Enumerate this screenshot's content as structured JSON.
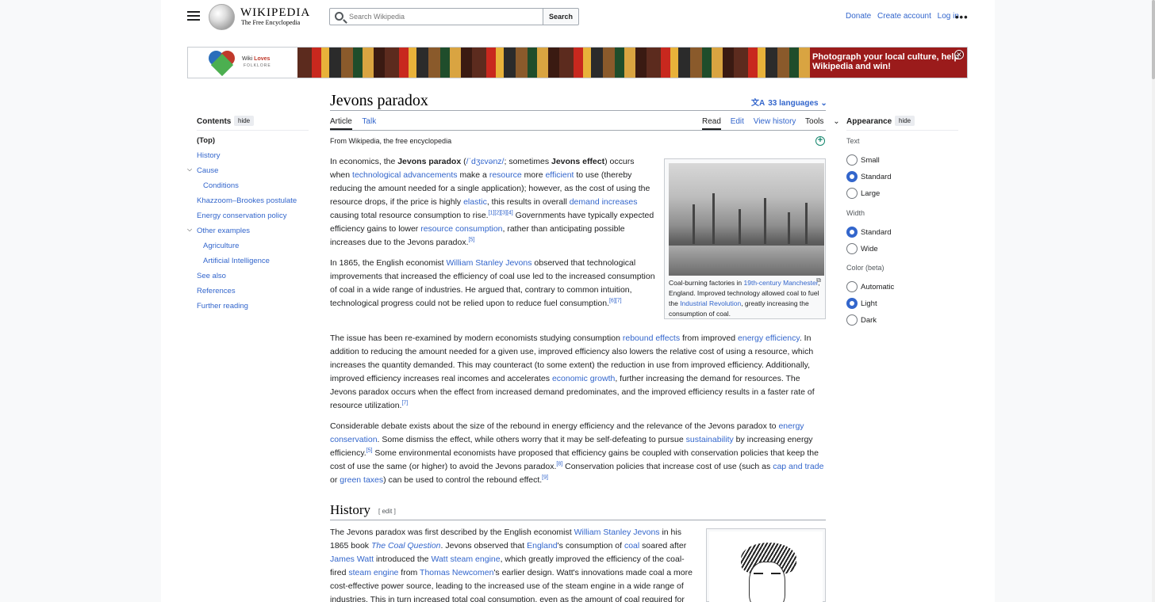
{
  "header": {
    "wordmark": "WIKIPEDIA",
    "tagline": "The Free Encyclopedia",
    "search_placeholder": "Search Wikipedia",
    "search_button": "Search",
    "links": [
      "Donate",
      "Create account",
      "Log in"
    ],
    "more": "•••"
  },
  "banner": {
    "logo_text_1": "Wiki",
    "logo_text_2": "Loves",
    "logo_sub": "FOLKLORE",
    "cta": "Photograph your local culture, help Wikipedia and win!",
    "close": "✕"
  },
  "toc": {
    "title": "Contents",
    "hide": "hide",
    "items": [
      {
        "label": "(Top)",
        "bold": true
      },
      {
        "label": "History"
      },
      {
        "label": "Cause",
        "expand": true
      },
      {
        "label": "Conditions",
        "sub": true
      },
      {
        "label": "Khazzoom–Brookes postulate"
      },
      {
        "label": "Energy conservation policy"
      },
      {
        "label": "Other examples",
        "expand": true
      },
      {
        "label": "Agriculture",
        "sub": true
      },
      {
        "label": "Artificial Intelligence",
        "sub": true
      },
      {
        "label": "See also"
      },
      {
        "label": "References"
      },
      {
        "label": "Further reading"
      }
    ]
  },
  "article": {
    "title": "Jevons paradox",
    "languages": "33 languages",
    "tabs_left": [
      "Article",
      "Talk"
    ],
    "tabs_right": [
      "Read",
      "Edit",
      "View history",
      "Tools"
    ],
    "from": "From Wikipedia, the free encyclopedia",
    "figure_caption_parts": [
      "Coal-burning factories in ",
      "19th-century Manchester",
      ", England. Improved technology allowed coal to fuel the ",
      "Industrial Revolution",
      ", greatly increasing the consumption of coal."
    ],
    "section_history": "History",
    "edit": "[ edit ]"
  },
  "appearance": {
    "title": "Appearance",
    "hide": "hide",
    "text_label": "Text",
    "text_options": [
      "Small",
      "Standard",
      "Large"
    ],
    "text_selected": "Standard",
    "width_label": "Width",
    "width_options": [
      "Standard",
      "Wide"
    ],
    "width_selected": "Standard",
    "color_label": "Color (beta)",
    "color_options": [
      "Automatic",
      "Light",
      "Dark"
    ],
    "color_selected": "Light"
  },
  "colors": {
    "link": "#3366cc",
    "text": "#202122",
    "banner_red": "#9b1b1b"
  }
}
